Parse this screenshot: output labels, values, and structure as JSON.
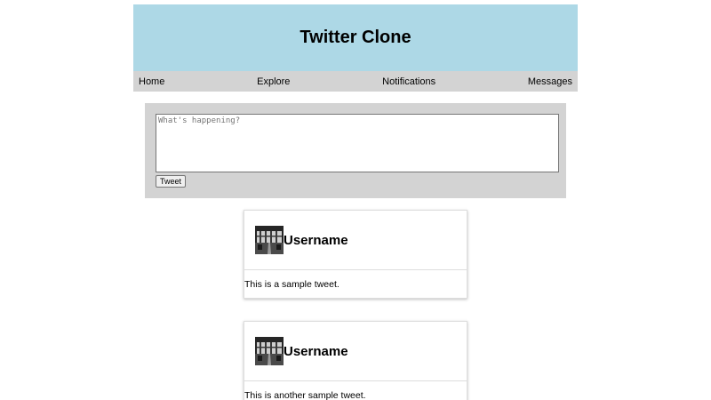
{
  "header": {
    "title": "Twitter Clone"
  },
  "nav": {
    "items": [
      {
        "label": "Home"
      },
      {
        "label": "Explore"
      },
      {
        "label": "Notifications"
      },
      {
        "label": "Messages"
      }
    ]
  },
  "composer": {
    "placeholder": "What's happening?",
    "value": "",
    "button_label": "Tweet"
  },
  "tweets": [
    {
      "username": "Username",
      "text": "This is a sample tweet."
    },
    {
      "username": "Username",
      "text": "This is another sample tweet."
    }
  ],
  "colors": {
    "header_bg": "#add8e6",
    "nav_bg": "#d3d3d3",
    "composer_bg": "#d3d3d3"
  },
  "icons": {
    "avatar": "avatar-photo-icon"
  }
}
